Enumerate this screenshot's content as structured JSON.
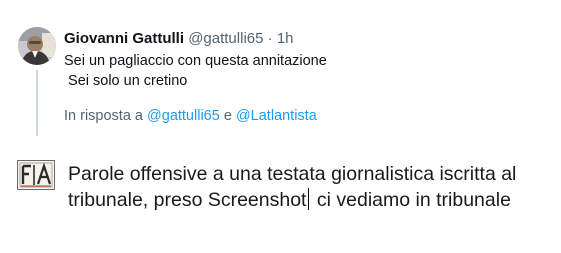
{
  "tweet": {
    "display_name": "Giovanni Gattulli",
    "handle": "@gattulli65",
    "separator": "·",
    "time": "1h",
    "body": "Sei un pagliaccio con questa annitazione\n Sei solo un cretino",
    "reply_prefix": "In risposta a",
    "reply_mention_1": "@gattulli65",
    "reply_conjunction": "e",
    "reply_mention_2": "@Latlantista",
    "mention_color": "#1d9bf0"
  },
  "comment": {
    "logo_icon": "fia-logo-icon",
    "text_before_caret": "Parole offensive a una testata giornalistica iscritta al tribunale, preso Screenshot",
    "text_after_caret": "  ci vediamo in tribunale"
  }
}
